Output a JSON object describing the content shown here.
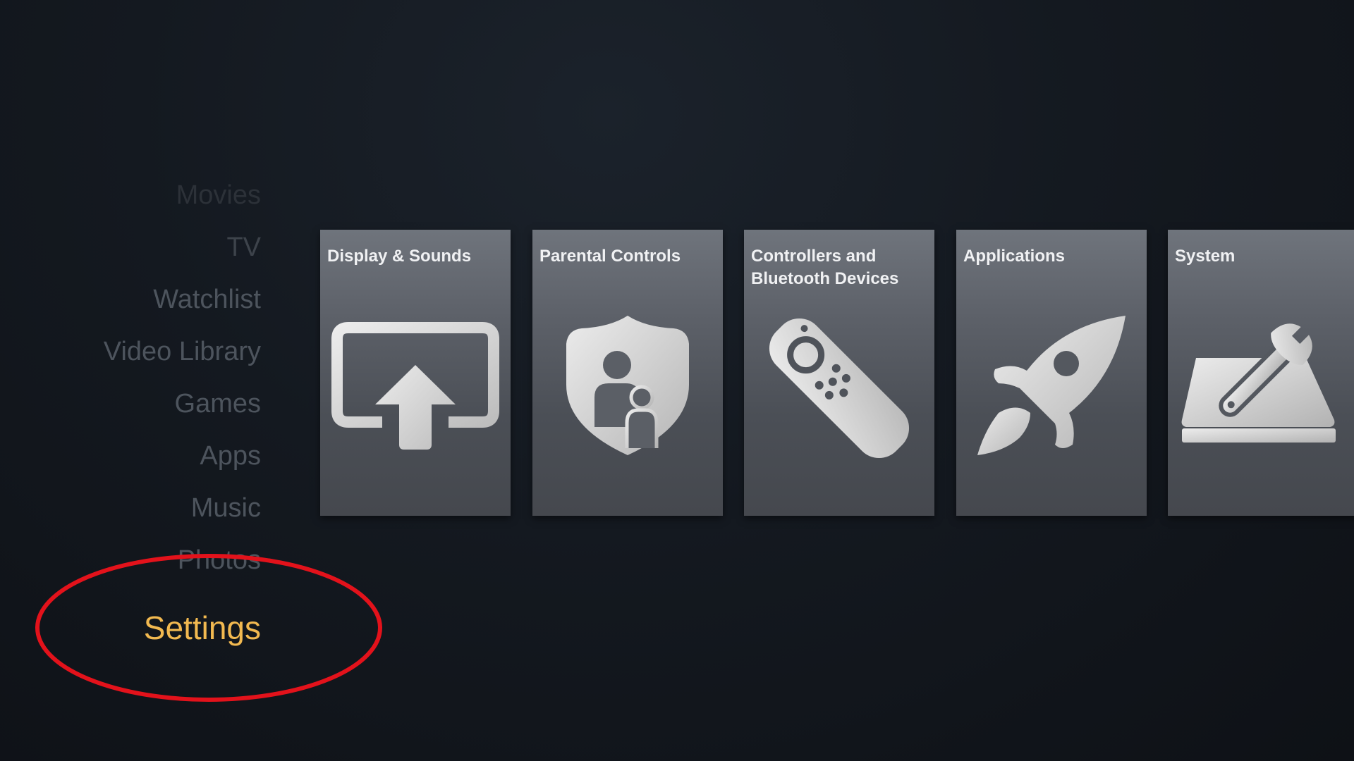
{
  "menu": {
    "items": [
      {
        "label": "Movies"
      },
      {
        "label": "TV"
      },
      {
        "label": "Watchlist"
      },
      {
        "label": "Video Library"
      },
      {
        "label": "Games"
      },
      {
        "label": "Apps"
      },
      {
        "label": "Music"
      },
      {
        "label": "Photos"
      },
      {
        "label": "Settings",
        "selected": true
      }
    ]
  },
  "tiles": [
    {
      "title": "Display & Sounds",
      "icon": "display-upload-icon"
    },
    {
      "title": "Parental Controls",
      "icon": "shield-family-icon"
    },
    {
      "title": "Controllers and Bluetooth Devices",
      "icon": "remote-control-icon"
    },
    {
      "title": "Applications",
      "icon": "rocket-icon"
    },
    {
      "title": "System",
      "icon": "system-wrench-icon"
    }
  ],
  "colors": {
    "selected_text": "#f2b950",
    "menu_text": "#4d545d",
    "annotation": "#e3121b",
    "tile_top": "#6f747c",
    "tile_bottom": "#45484e"
  }
}
